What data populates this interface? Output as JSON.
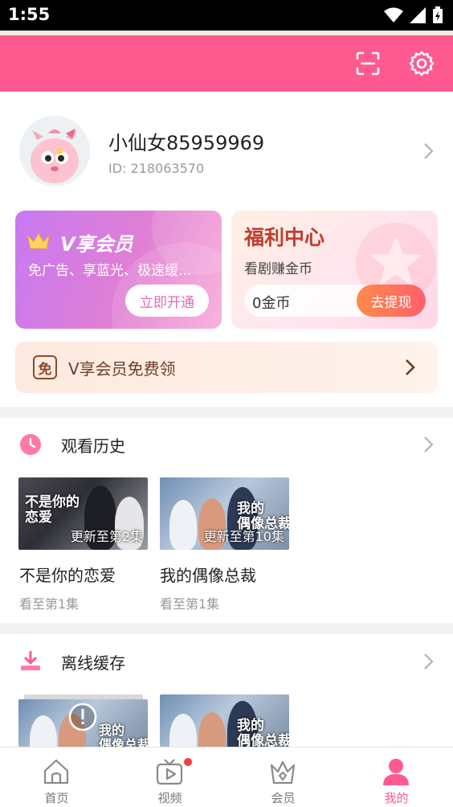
{
  "status_bar": {
    "time": "1:55"
  },
  "profile": {
    "username": "小仙女85959969",
    "user_id": "ID: 218063570"
  },
  "vip_card": {
    "title": "V享会员",
    "subtitle": "免广告、享蓝光、极速缓...",
    "button": "立即开通"
  },
  "welfare_card": {
    "title": "福利中心",
    "subtitle": "看剧赚金币",
    "coins": "0金币",
    "button": "去提现"
  },
  "free_bar": {
    "badge": "免",
    "text": "V享会员免费领"
  },
  "history": {
    "title": "观看历史",
    "items": [
      {
        "title": "不是你的恋爱",
        "update": "更新至第2集",
        "progress": "看至第1集",
        "art_text": "不是你的\n恋爱"
      },
      {
        "title": "我的偶像总裁",
        "update": "更新至第10集",
        "progress": "看至第1集",
        "art_text": "我的\n偶像总裁"
      }
    ]
  },
  "offline": {
    "title": "离线缓存",
    "items": [
      {
        "art_text": "我的\n偶像总裁"
      },
      {
        "art_text": "我的\n偶像总裁"
      }
    ]
  },
  "bottom_nav": {
    "items": [
      {
        "label": "首页"
      },
      {
        "label": "视频"
      },
      {
        "label": "会员"
      },
      {
        "label": "我的"
      }
    ]
  },
  "colors": {
    "brand_pink": "#ff5a8f",
    "vip_purple": "#c779f2",
    "welfare_red": "#c23d2d",
    "withdraw_orange": "#ff6b5b"
  }
}
